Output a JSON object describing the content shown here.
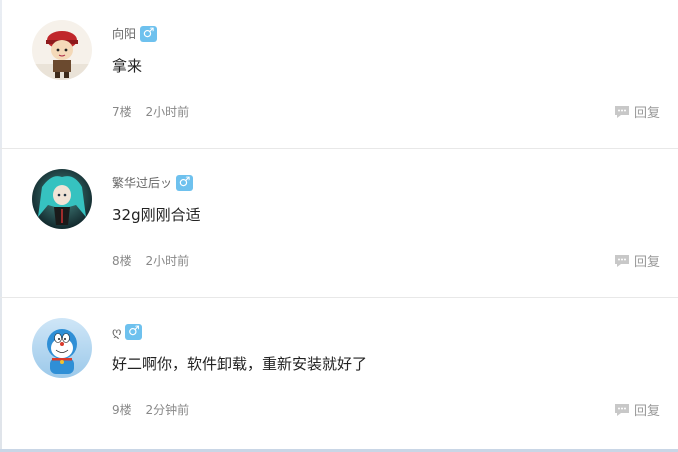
{
  "replies": [
    {
      "username": "向阳",
      "gender_icon": "♂",
      "content": "拿来",
      "floor": "7楼",
      "time": "2小时前",
      "reply_label": "回复"
    },
    {
      "username": "繁华过后ッ",
      "gender_icon": "♂",
      "content": "32g刚刚合适",
      "floor": "8楼",
      "time": "2小时前",
      "reply_label": "回复"
    },
    {
      "username": "ღ",
      "gender_icon": "♂",
      "content": "好二啊你，软件卸载，重新安装就好了",
      "floor": "9楼",
      "time": "2分钟前",
      "reply_label": "回复"
    }
  ],
  "colors": {
    "gender_badge": "#6ec1ee",
    "meta_text": "#888888",
    "divider": "#e8e8e8"
  },
  "icons": {
    "gender": "male-icon",
    "reply": "speech-bubble-icon"
  }
}
